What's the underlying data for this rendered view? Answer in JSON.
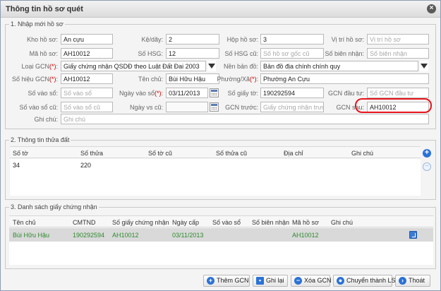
{
  "window": {
    "title": "Thông tin hồ sơ quét"
  },
  "sections": {
    "entry": {
      "legend": "1. Nhập mới hồ sơ"
    },
    "land": {
      "legend": "2. Thông tin thửa đất"
    },
    "certs": {
      "legend": "3. Danh sách giấy chứng nhận"
    }
  },
  "form": {
    "kho_ho_so": {
      "label": "Kho hồ sơ:",
      "value": "An cựu"
    },
    "ke_day": {
      "label": "Kệ/dãy:",
      "value": "2"
    },
    "hop_ho_so": {
      "label": "Hộp hồ sơ:",
      "value": "3"
    },
    "vi_tri_ho_so": {
      "label": "Vị trí hồ sơ:",
      "placeholder": "Vị trí hồ sơ"
    },
    "ma_ho_so": {
      "label": "Mã hồ sơ:",
      "value": "AH10012"
    },
    "so_hsg": {
      "label": "Số HSG:",
      "value": "12"
    },
    "so_hsg_cu": {
      "label": "Số HSG cũ:",
      "placeholder": "Số hồ sơ gốc cũ"
    },
    "so_bien_nhan": {
      "label": "Số biên nhận:",
      "placeholder": "Số biên nhận"
    },
    "loai_gcn": {
      "label": "Loại GCN",
      "req": "(*)",
      "colon": ":",
      "value": "Giấy chứng nhận QSDĐ theo Luật Đất Đai 2003"
    },
    "nen_ban_do": {
      "label": "Nền bản đồ:",
      "value": "Bản đồ địa chính chính quy"
    },
    "so_hieu_gcn": {
      "label": "Số hiệu GCN",
      "req": "(*)",
      "colon": ":",
      "value": "AH10012"
    },
    "ten_chu": {
      "label": "Tên chủ:",
      "value": "Bùi Hữu  Hậu"
    },
    "phuong_xa": {
      "label": "Phường/Xã",
      "req": "(*)",
      "colon": ":",
      "value": "Phường An Cựu"
    },
    "so_vao_so": {
      "label": "Số vào sổ:",
      "placeholder": "Số vào sổ"
    },
    "ngay_vao_so": {
      "label": "Ngày vào sổ",
      "req": "(*)",
      "colon": ":",
      "value": "03/11/2013"
    },
    "so_giay_to": {
      "label": "Số giấy tờ:",
      "value": "190292594"
    },
    "gcn_dau_tu": {
      "label": "GCN đầu tư:",
      "placeholder": "Số GCN đầu tư"
    },
    "so_vao_so_cu": {
      "label": "Số vào sổ cũ:",
      "placeholder": "Số vào sổ cũ"
    },
    "ngay_vs_cu": {
      "label": "Ngày vs cũ:"
    },
    "gcn_truoc": {
      "label": "GCN trước:",
      "placeholder": "Giấy chứng nhận trước"
    },
    "gcn_sau": {
      "label": "GCN sau:",
      "value": "AH10012"
    },
    "ghi_chu": {
      "label": "Ghi chú:",
      "placeholder": "Ghi chú"
    }
  },
  "land_table": {
    "headers": [
      "Số tờ",
      "Số thửa",
      "Số tờ cũ",
      "Số thửa cũ",
      "Địa chỉ",
      "Ghi chú"
    ],
    "rows": [
      [
        "34",
        "220",
        "",
        "",
        "",
        ""
      ]
    ]
  },
  "cert_table": {
    "headers": [
      "Tên chủ",
      "CMTND",
      "Số giấy chứng nhận",
      "Ngày cấp",
      "Số vào sổ",
      "Số biên nhận",
      "Mã hồ sơ",
      "Ghi chú"
    ],
    "rows": [
      [
        "Bùi Hữu Hậu",
        "190292594",
        "AH10012",
        "03/11/2013",
        "",
        "",
        "AH10012",
        ""
      ]
    ]
  },
  "buttons": {
    "add_gcn": "Thêm GCN",
    "save": "Ghi lại",
    "delete_gcn": "Xóa GCN",
    "convert": "Chuyển thành LS",
    "exit": "Thoát"
  },
  "colors": {
    "accent": "#2b72d6",
    "required": "#d00000",
    "row_text": "#2e8b2e",
    "highlight": "#e8141c"
  }
}
